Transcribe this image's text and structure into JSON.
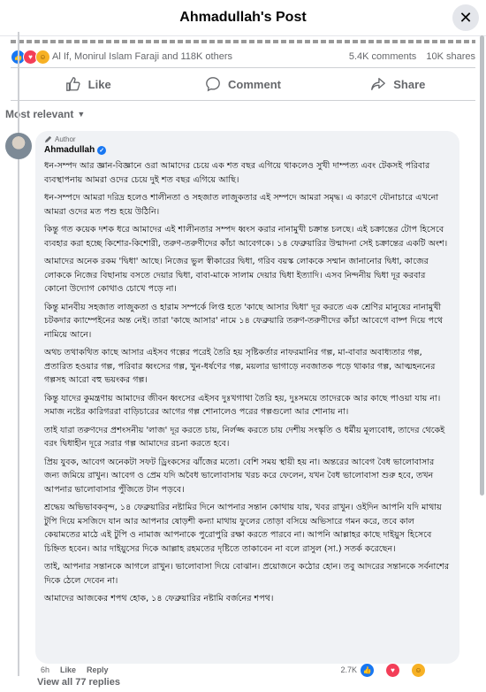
{
  "header": {
    "title": "Ahmadullah's Post",
    "close_icon": "close-icon"
  },
  "reactions": {
    "names": "Al If, Monirul Islam Faraji and 118K others",
    "comments": "5.4K comments",
    "shares": "10K shares",
    "icons": [
      "like-icon",
      "love-icon",
      "care-icon"
    ]
  },
  "actions": {
    "like": "Like",
    "comment": "Comment",
    "share": "Share"
  },
  "sort": {
    "label": "Most relevant"
  },
  "comment": {
    "badge": "Author",
    "author": "Ahmadullah",
    "paragraphs": [
      "ধন-সম্পদ আর জ্ঞান-বিজ্ঞানে ওরা আমাদের চেয়ে এক শত বছর এগিয়ে থাকলেও সুখী দাম্পত্য এবং টেকসই পরিবার ব্যবস্থাপনায় আমরা ওদের চেয়ে দুই শত বছর এগিয়ে আছি।",
      "ধন-সম্পদে আমরা দরিদ্র হলেও শালীনতা ও সহজাত লাজুকতার এই সম্পদে আমরা সমৃদ্ধ। এ কারণে যৌনাচারে এখনো আমরা ওদের মত পশু হয়ে উঠিনি।",
      "কিন্তু গত কয়েক দশক ধরে আমাদের এই শালীনতার সম্পদ ধ্বংস করার নানামুখী চক্রান্ত চলছে। এই চক্রান্তের টোপ হিসেবে ব্যবহার করা হচ্ছে কিশোর-কিশোরী, তরুণ-তরুণীদের কাঁচা আবেগকে। ১৪ ফেব্রুয়ারির উন্মাদনা সেই চক্রান্তের একটি অংশ।",
      "আমাদের অনেক রকম 'দ্বিধা' আছে। নিজের ভুল স্বীকারের দ্বিধা, গরিব বয়স্ক লোককে সম্মান জানানোর দ্বিধা, কাজের লোককে নিজের বিছানায় বসতে দেয়ার দ্বিধা, বাবা-মাকে সালাম দেয়ার দ্বিধা ইত্যাদি। এসব নিন্দনীয় দ্বিধা দূর করবার কোনো উদ্যোগ কোথাও চোখে পড়ে না।",
      "কিন্তু মানবীয় সহজাত লাজুকতা ও হারাম সম্পর্কে লিপ্ত হতে 'কাছে আসার দ্বিধা' দূর করতে এক শ্রেণির মানুষের নানামুখী চটকদার ক্যাম্পেইনের অন্ত নেই। তারা 'কাছে আসার' নামে ১৪ ফেব্রুয়ারি তরুণ-তরুণীদের কাঁচা আবেগে বাষ্প দিয়ে পথে নামিয়ে আনে।",
      "অথচ তথাকথিত কাছে আসার এইসব গল্পের পরেই তৈরি হয় সৃষ্টিকর্তার নাফরমানির গল্প, মা-বাবার অবাধ্যতার গল্প, প্রতারিত হওয়ার গল্প, পরিবার ধ্বংসের গল্প, খুন-ধর্ষণের গল্প, ময়লার ভাগাড়ে নবজাতক পড়ে থাকার গল্প, আত্মহননের গল্পসহ আরো বহু ভয়ংকর গল্প।",
      "কিন্তু যাদের কুমন্ত্রণায় আমাদের জীবন ধ্বংসের এইসব দুঃখগাথা তৈরি হয়, দুঃসময়ে তাদেরকে আর কাছে পাওয়া যায় না। সমাজ নষ্টের কারিগররা বাড়িচারের আগের গল্প শোনালেও পরের গল্পগুলো আর শোনায় না।",
      "তাই যারা তরুণদের প্রশংসনীয় 'লাজ' দূর করতে চায়, নির্লজ্জ করতে চায় দেশীয় সংস্কৃতি ও ধর্মীয় মূল্যবোধ, তাদের থেকেই বরং দ্বিধাহীন দূরে সরার গল্প আমাদের রচনা করতে হবে।",
      "প্রিয় যুবক, আবেগ অনেকটা সফট ড্রিংকসের ঝাঁজের মতো। বেশি সময় স্থায়ী হয় না। অন্তরের আবেগ বৈধ ভালোবাসার জন্য জমিয়ে রাখুন। আবেগ ও প্রেম যদি অবৈধ ভালোবাসায় খরচ করে ফেলেন, যখন বৈধ ভালোবাসা শুরু হবে, তখন আপনার ভালোবাসার পুঁজিতে টান পড়বে।",
      "শ্রদ্ধেয় অভিভাবকবৃন্দ, ১৪ ফেব্রুয়ারির নষ্টামির দিনে আপনার সন্তান কোথায় যায়, খবর রাখুন। ওইদিন আপনি যদি মাথায় টুপি দিয়ে মসজিদে যান আর আপনার ষোড়শী কন্যা মাথায় ফুলের তোড়া বসিয়ে অভিসারে গমন করে, তবে কাল কেয়ামতের মাঠে এই টুপি ও নামাজ আপনাকে পুরোপুরি রক্ষা করতে পারবে না। আপনি আল্লাহর কাছে দাইয়ুস হিসেবে চিহ্নিত হবেন। আর দাইয়ুসের দিকে আল্লাহ রহমতের দৃষ্টিতে তাকাবেন না বলে রাসুল (সা.) সতর্ক করেছেন।",
      "তাই, আপনার সন্তানকে আগলে রাখুন। ভালোবাসা দিয়ে বোঝান। প্রয়োজনে কঠোর হোন। তবু আদরের সন্তানকে সর্বনাশের দিকে ঠেলে দেবেন না।",
      "আমাদের আজকের শপথ হোক, ১৪ ফেব্রুয়ারির নষ্টামি বর্জনের শপথ।"
    ],
    "time": "6h",
    "like": "Like",
    "reply": "Reply",
    "react_count": "2.7K"
  },
  "view_all": "View all 77 replies"
}
